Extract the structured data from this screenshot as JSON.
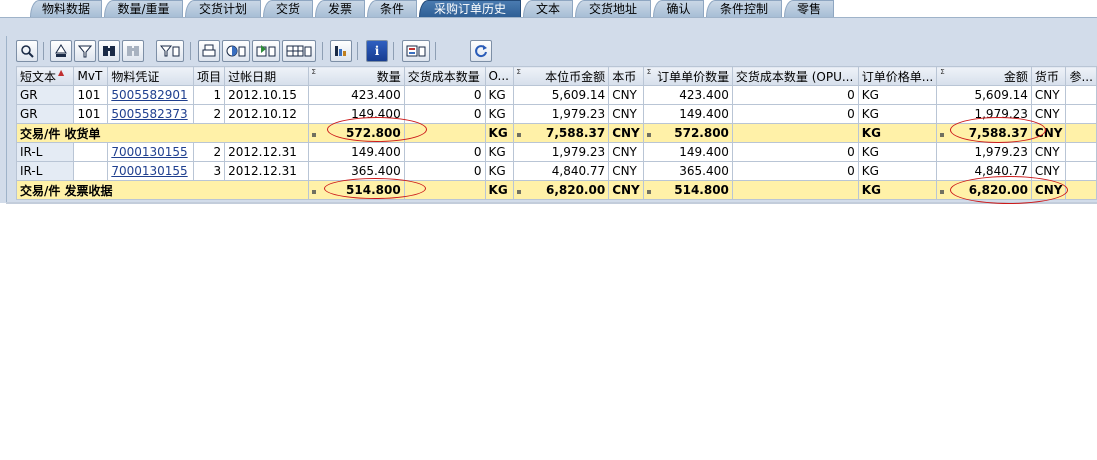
{
  "tabs": [
    {
      "label": "物料数据",
      "active": false
    },
    {
      "label": "数量/重量",
      "active": false
    },
    {
      "label": "交货计划",
      "active": false
    },
    {
      "label": "交货",
      "active": false
    },
    {
      "label": "发票",
      "active": false
    },
    {
      "label": "条件",
      "active": false
    },
    {
      "label": "采购订单历史",
      "active": true
    },
    {
      "label": "文本",
      "active": false
    },
    {
      "label": "交货地址",
      "active": false
    },
    {
      "label": "确认",
      "active": false
    },
    {
      "label": "条件控制",
      "active": false
    },
    {
      "label": "零售",
      "active": false
    }
  ],
  "toolbar": {
    "buttons": [
      {
        "name": "details-icon",
        "glyph": "🔍"
      },
      {
        "name": "sort-ascending-icon",
        "glyph": "▲"
      },
      {
        "name": "filter-icon",
        "glyph": "▼"
      },
      {
        "name": "find-icon",
        "glyph": "⌕"
      },
      {
        "name": "find-next-icon",
        "glyph": "⌕"
      },
      {
        "name": "total-icon",
        "glyph": "Σ"
      },
      {
        "name": "print-icon",
        "glyph": "⎙"
      },
      {
        "name": "views-icon",
        "glyph": "◧"
      },
      {
        "name": "export-icon",
        "glyph": "⇪"
      },
      {
        "name": "layout-icon",
        "glyph": "▦"
      },
      {
        "name": "graphic-icon",
        "glyph": "▥"
      },
      {
        "name": "info-icon",
        "glyph": "i"
      },
      {
        "name": "variant-icon",
        "glyph": "▤"
      },
      {
        "name": "refresh-icon",
        "glyph": "⟳"
      }
    ]
  },
  "grid": {
    "columns": [
      "短文本",
      "MvT",
      "物料凭证",
      "项目",
      "过帐日期",
      "数量",
      "交货成本数量",
      "O...",
      "本位币金额",
      "本币",
      "订单单价数量",
      "交货成本数量 (OPU...",
      "订单价格单...",
      "金额",
      "货币",
      "参..."
    ],
    "rows": [
      {
        "type": "item",
        "cells": [
          "GR",
          "101",
          "5005582901",
          "1",
          "2012.10.15",
          "423.400",
          "0",
          "KG",
          "5,609.14",
          "CNY",
          "423.400",
          "0",
          "KG",
          "5,609.14",
          "CNY",
          ""
        ]
      },
      {
        "type": "item",
        "cells": [
          "GR",
          "101",
          "5005582373",
          "2",
          "2012.10.12",
          "149.400",
          "0",
          "KG",
          "1,979.23",
          "CNY",
          "149.400",
          "0",
          "KG",
          "1,979.23",
          "CNY",
          ""
        ]
      },
      {
        "type": "sum",
        "cells": [
          "交易/件 收货单",
          "",
          "",
          "",
          "",
          "572.800",
          "",
          "KG",
          "7,588.37",
          "CNY",
          "572.800",
          "",
          "KG",
          "7,588.37",
          "CNY",
          ""
        ]
      },
      {
        "type": "item",
        "cells": [
          "IR-L",
          "",
          "7000130155",
          "2",
          "2012.12.31",
          "149.400",
          "0",
          "KG",
          "1,979.23",
          "CNY",
          "149.400",
          "0",
          "KG",
          "1,979.23",
          "CNY",
          ""
        ]
      },
      {
        "type": "item",
        "cells": [
          "IR-L",
          "",
          "7000130155",
          "3",
          "2012.12.31",
          "365.400",
          "0",
          "KG",
          "4,840.77",
          "CNY",
          "365.400",
          "0",
          "KG",
          "4,840.77",
          "CNY",
          ""
        ]
      },
      {
        "type": "sum",
        "cells": [
          "交易/件 发票收据",
          "",
          "",
          "",
          "",
          "514.800",
          "",
          "KG",
          "6,820.00",
          "CNY",
          "514.800",
          "",
          "KG",
          "6,820.00",
          "CNY",
          ""
        ]
      }
    ]
  },
  "colors": {
    "sum_row_background": "#fff1a8",
    "highlight_ellipse": "#cc1a1a",
    "active_tab": "#2f5f95"
  }
}
